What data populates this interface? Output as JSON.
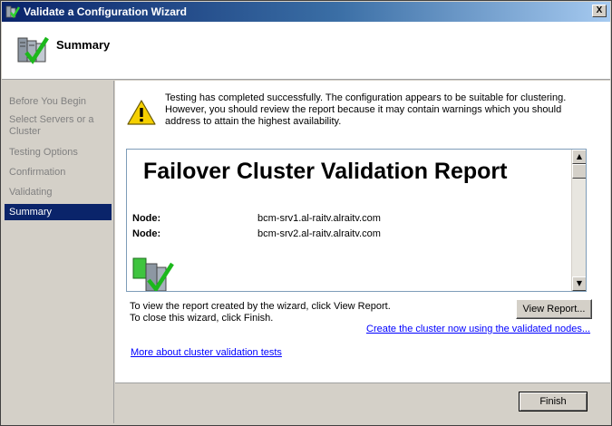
{
  "window": {
    "title": "Validate a Configuration Wizard",
    "close_label": "X"
  },
  "header": {
    "title": "Summary"
  },
  "sidebar": {
    "items": [
      {
        "label": "Before You Begin"
      },
      {
        "label": "Select Servers or a Cluster"
      },
      {
        "label": "Testing Options"
      },
      {
        "label": "Confirmation"
      },
      {
        "label": "Validating"
      },
      {
        "label": "Summary",
        "active": true
      }
    ]
  },
  "content": {
    "status_text": "Testing has completed successfully. The configuration appears to be suitable for clustering. However, you should review the report because it may contain warnings which you should address to attain the highest availability.",
    "report": {
      "title": "Failover Cluster Validation Report",
      "nodes": [
        {
          "label": "Node:",
          "value": "bcm-srv1.al-raitv.alraitv.com"
        },
        {
          "label": "Node:",
          "value": "bcm-srv2.al-raitv.alraitv.com"
        }
      ]
    },
    "hint_line1": "To view the report created by the wizard, click View Report.",
    "hint_line2": "To close this wizard, click Finish.",
    "view_report_label": "View Report...",
    "create_cluster_link": "Create the cluster now using the validated nodes...",
    "more_link": "More about cluster validation tests"
  },
  "footer": {
    "finish_label": "Finish"
  },
  "colors": {
    "selection": "#0a246a",
    "link": "#0000ff",
    "window_bg": "#d4d0c8"
  }
}
